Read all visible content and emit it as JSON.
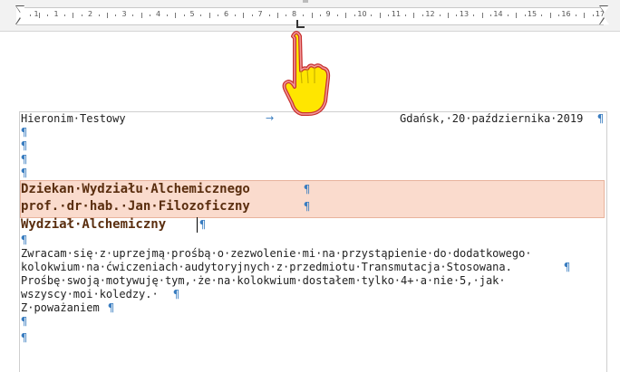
{
  "ruler": {
    "numbers": [
      "1",
      "1",
      "2",
      "3",
      "4",
      "5",
      "6",
      "7",
      "8",
      "9",
      "10",
      "11",
      "12",
      "13",
      "14",
      "15",
      "16",
      "17"
    ]
  },
  "document": {
    "sender": "Hieronim·Testowy",
    "place_date": "Gdańsk,·20·października·2019",
    "pilcrow": "¶",
    "tab_arrow": "→",
    "address_lines": [
      "Dziekan·Wydziału·Alchemicznego",
      "prof.·dr·hab.·Jan·Filozoficzny",
      "Wydział·Alchemiczny"
    ],
    "body_lines": [
      "Zwracam·się·z·uprzejmą·prośbą·o·zezwolenie·mi·na·przystąpienie·do·dodatkowego·",
      "kolokwium·na·ćwiczeniach·audytoryjnych·z·przedmiotu·Transmutacja·Stosowana.",
      "Prośbę·swoją·motywuję·tym,·że·na·kolokwium·dostałem·tylko·4+·a·nie·5,·jak·",
      "wszyscy·moi·koledzy.·",
      "Z·poważaniem"
    ]
  },
  "colors": {
    "highlight": "#fadbcd",
    "pilcrow": "#3a7dc0",
    "hand": "#ffe600"
  },
  "icons": {
    "pointer": "hand-pointer-icon"
  }
}
